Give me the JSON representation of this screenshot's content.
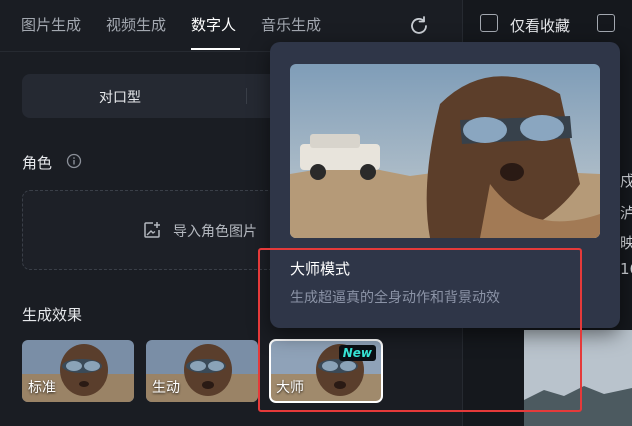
{
  "tabs": [
    {
      "label": "图片生成"
    },
    {
      "label": "视频生成"
    },
    {
      "label": "数字人"
    },
    {
      "label": "音乐生成"
    }
  ],
  "mode_switch": {
    "left_label": "对口型"
  },
  "role_section": {
    "label": "角色"
  },
  "upload": {
    "label": "导入角色图片"
  },
  "effect_section": {
    "label": "生成效果",
    "cards": [
      {
        "label": "标准"
      },
      {
        "label": "生动"
      },
      {
        "label": "大师",
        "badge": "New"
      }
    ]
  },
  "right_panel": {
    "fav_label": "仅看收藏",
    "partial_chars": [
      "戍",
      "泸",
      "映",
      "16"
    ]
  },
  "popup": {
    "title": "大师模式",
    "description": "生成超逼真的全身动作和背景动效"
  },
  "colors": {
    "highlight": "#e53a3a",
    "new_badge_text": "#37e6d7",
    "popup_bg": "#2f3648"
  }
}
